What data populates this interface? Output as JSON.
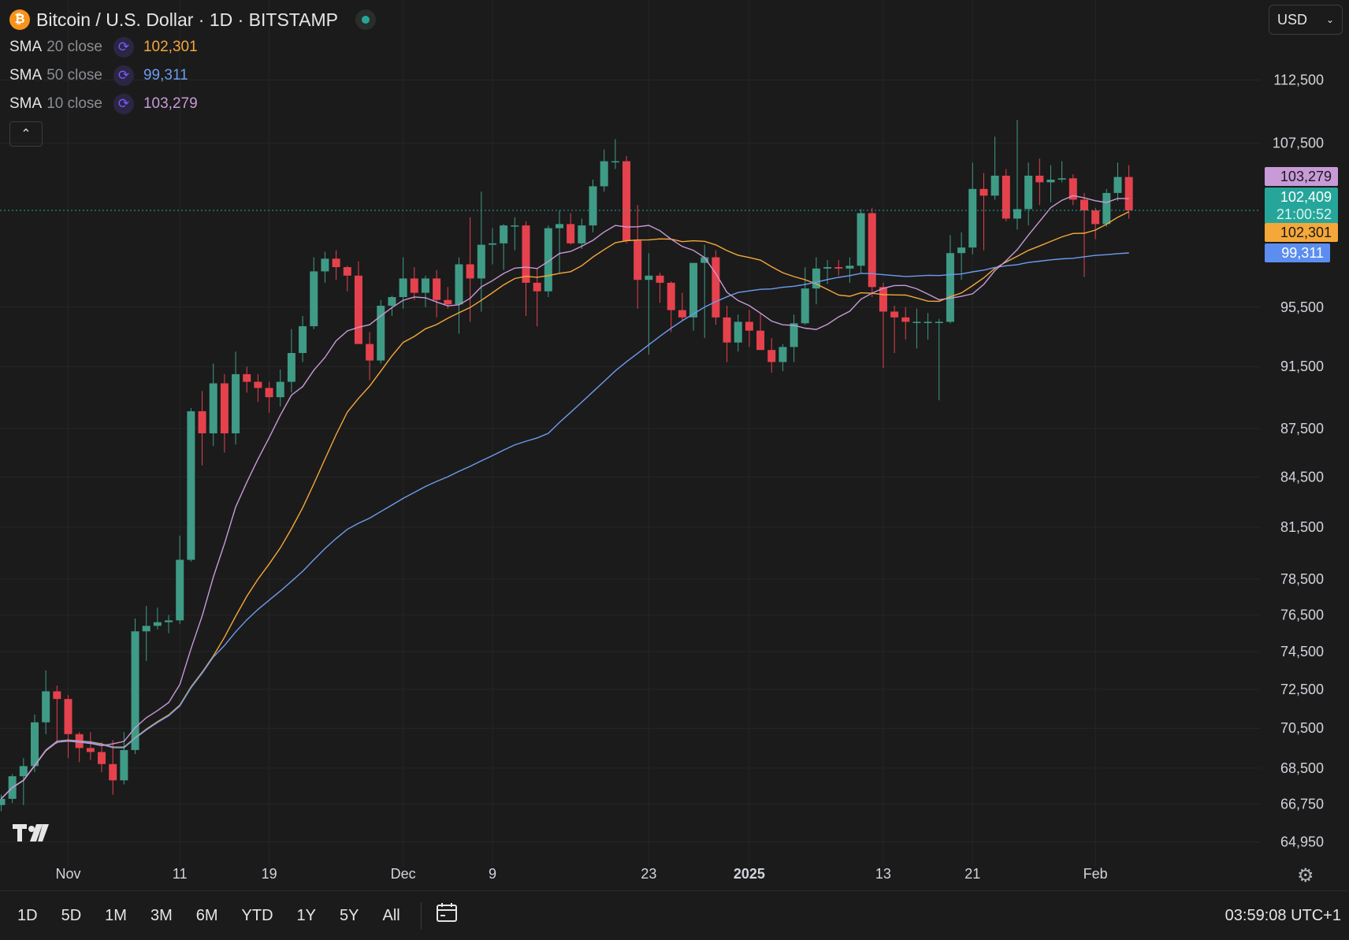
{
  "header": {
    "title": "Bitcoin / U.S. Dollar · 1D · BITSTAMP",
    "coin_glyph": "₿",
    "currency": "USD"
  },
  "indicators": [
    {
      "name": "SMA",
      "params": "20 close",
      "value": "102,301",
      "color": "#f5a83a"
    },
    {
      "name": "SMA",
      "params": "50 close",
      "value": "99,311",
      "color": "#6d9cf0"
    },
    {
      "name": "SMA",
      "params": "10 close",
      "value": "103,279",
      "color": "#c89ad8"
    }
  ],
  "price_scale": {
    "labels": [
      "112,500",
      "107,500",
      "95,500",
      "91,500",
      "87,500",
      "84,500",
      "81,500",
      "78,500",
      "76,500",
      "74,500",
      "72,500",
      "70,500",
      "68,500",
      "66,750",
      "64,950"
    ],
    "tags": [
      {
        "text": "103,279",
        "color": "#c89ad8"
      },
      {
        "text": "102,409",
        "sub": "21:00:52",
        "color": "#26a69a"
      },
      {
        "text": "102,301",
        "color": "#f5a83a"
      },
      {
        "text": "99,311",
        "color": "#5b8ef0"
      }
    ]
  },
  "time_axis": {
    "labels": [
      "Nov",
      "11",
      "19",
      "Dec",
      "9",
      "23",
      "2025",
      "13",
      "21",
      "Feb"
    ]
  },
  "chart_data": {
    "type": "candlestick",
    "series_name": "Bitcoin / U.S. Dollar",
    "interval": "1D",
    "y_scale": "log",
    "ylim": [
      63800,
      116500
    ],
    "start_date": "2024-10-26",
    "ohlc": [
      [
        66700,
        67200,
        66400,
        67000
      ],
      [
        67000,
        68200,
        66800,
        68100
      ],
      [
        68100,
        69000,
        66700,
        68600
      ],
      [
        68600,
        71200,
        68300,
        70800
      ],
      [
        70800,
        73500,
        70200,
        72400
      ],
      [
        72400,
        72700,
        69700,
        72000
      ],
      [
        72000,
        72200,
        69000,
        70200
      ],
      [
        70200,
        70300,
        68800,
        69500
      ],
      [
        69500,
        70300,
        68900,
        69300
      ],
      [
        69300,
        69800,
        68300,
        68700
      ],
      [
        68700,
        69900,
        67200,
        67900
      ],
      [
        67900,
        70300,
        67700,
        69400
      ],
      [
        69400,
        76300,
        69200,
        75600
      ],
      [
        75600,
        77000,
        74000,
        75900
      ],
      [
        75900,
        76900,
        75700,
        76100
      ],
      [
        76100,
        76500,
        75500,
        76200
      ],
      [
        76200,
        81000,
        76000,
        79600
      ],
      [
        79600,
        88800,
        79500,
        88600
      ],
      [
        88600,
        89900,
        85200,
        87200
      ],
      [
        87200,
        91700,
        86400,
        90400
      ],
      [
        90400,
        91000,
        86000,
        87200
      ],
      [
        87200,
        92500,
        86500,
        91000
      ],
      [
        91000,
        91500,
        89800,
        90500
      ],
      [
        90500,
        91000,
        89200,
        90100
      ],
      [
        90100,
        90500,
        88500,
        89500
      ],
      [
        89500,
        91300,
        88900,
        90500
      ],
      [
        90500,
        94000,
        89800,
        92400
      ],
      [
        92400,
        94900,
        91800,
        94200
      ],
      [
        94200,
        99000,
        94000,
        98000
      ],
      [
        98000,
        99400,
        97200,
        98900
      ],
      [
        98900,
        99500,
        97400,
        98300
      ],
      [
        98300,
        98400,
        96600,
        97700
      ],
      [
        97700,
        98700,
        94800,
        93000
      ],
      [
        93000,
        93800,
        90600,
        91900
      ],
      [
        91900,
        96000,
        91700,
        95600
      ],
      [
        95600,
        96300,
        94900,
        96200
      ],
      [
        96200,
        99000,
        95400,
        97500
      ],
      [
        97500,
        98300,
        96000,
        96500
      ],
      [
        96500,
        97700,
        95500,
        97500
      ],
      [
        97500,
        98100,
        94800,
        96000
      ],
      [
        96000,
        96900,
        95400,
        95700
      ],
      [
        95700,
        99000,
        93700,
        98500
      ],
      [
        98500,
        101900,
        94500,
        97500
      ],
      [
        97500,
        103800,
        95200,
        99900
      ],
      [
        99900,
        101100,
        98500,
        100000
      ],
      [
        100000,
        101400,
        98100,
        101300
      ],
      [
        101300,
        101900,
        99500,
        101300
      ],
      [
        101300,
        101600,
        94900,
        97200
      ],
      [
        97200,
        98200,
        94200,
        96600
      ],
      [
        96600,
        101300,
        96200,
        101100
      ],
      [
        101100,
        102400,
        97900,
        101400
      ],
      [
        101400,
        102200,
        99900,
        100000
      ],
      [
        100000,
        101800,
        99600,
        101300
      ],
      [
        101300,
        104700,
        100800,
        104200
      ],
      [
        104200,
        107000,
        103800,
        106100
      ],
      [
        106100,
        107800,
        105500,
        106100
      ],
      [
        106100,
        106500,
        100000,
        100200
      ],
      [
        100200,
        102800,
        95400,
        97400
      ],
      [
        97400,
        99300,
        92300,
        97700
      ],
      [
        97700,
        97900,
        95800,
        97200
      ],
      [
        97200,
        97300,
        93800,
        95300
      ],
      [
        95300,
        96500,
        94600,
        94800
      ],
      [
        94800,
        96400,
        93900,
        98600
      ],
      [
        98600,
        99900,
        93400,
        99000
      ],
      [
        99000,
        99500,
        94300,
        94800
      ],
      [
        94800,
        95600,
        91800,
        93100
      ],
      [
        93100,
        95000,
        92500,
        94500
      ],
      [
        94500,
        95300,
        92800,
        93900
      ],
      [
        93900,
        95100,
        92600,
        92600
      ],
      [
        92600,
        93400,
        91100,
        91800
      ],
      [
        91800,
        93000,
        91200,
        92800
      ],
      [
        92800,
        95000,
        91800,
        94400
      ],
      [
        94400,
        98300,
        94300,
        96800
      ],
      [
        96800,
        99000,
        95700,
        98200
      ],
      [
        98200,
        98800,
        97100,
        98300
      ],
      [
        98300,
        98800,
        97700,
        98200
      ],
      [
        98200,
        99000,
        97200,
        98400
      ],
      [
        98400,
        102500,
        97900,
        102200
      ],
      [
        102200,
        102600,
        96200,
        96900
      ],
      [
        96900,
        97200,
        91400,
        95200
      ],
      [
        95200,
        95600,
        92400,
        94800
      ],
      [
        94800,
        95500,
        93300,
        94500
      ],
      [
        94500,
        95400,
        92700,
        94500
      ],
      [
        94500,
        95100,
        93300,
        94500
      ],
      [
        94500,
        94700,
        89300,
        94500
      ],
      [
        94500,
        100600,
        94400,
        99300
      ],
      [
        99300,
        100800,
        97400,
        99700
      ],
      [
        99700,
        106000,
        99200,
        104000
      ],
      [
        104000,
        105200,
        99500,
        103500
      ],
      [
        103500,
        108000,
        103200,
        105000
      ],
      [
        105000,
        105500,
        101600,
        101800
      ],
      [
        101800,
        109300,
        101000,
        102500
      ],
      [
        102500,
        106000,
        101300,
        105000
      ],
      [
        105000,
        106300,
        102800,
        104500
      ],
      [
        104500,
        105800,
        103000,
        104700
      ],
      [
        104700,
        106100,
        104500,
        104800
      ],
      [
        104800,
        105100,
        102800,
        103200
      ],
      [
        103200,
        103700,
        97600,
        102400
      ],
      [
        102400,
        102600,
        100300,
        101400
      ],
      [
        101400,
        104000,
        101200,
        103700
      ],
      [
        103700,
        106000,
        103100,
        104900
      ],
      [
        104900,
        105800,
        101800,
        102409
      ]
    ],
    "sma": [
      {
        "name": "SMA 20 close",
        "value": 102301,
        "color": "#f5a83a"
      },
      {
        "name": "SMA 50 close",
        "value": 99311,
        "color": "#6d9cf0"
      },
      {
        "name": "SMA 10 close",
        "value": 103279,
        "color": "#c89ad8"
      }
    ],
    "last_price": 102409
  },
  "toolbar": {
    "periods": [
      "1D",
      "5D",
      "1M",
      "3M",
      "6M",
      "YTD",
      "1Y",
      "5Y",
      "All"
    ],
    "clock": "03:59:08 UTC+1"
  }
}
